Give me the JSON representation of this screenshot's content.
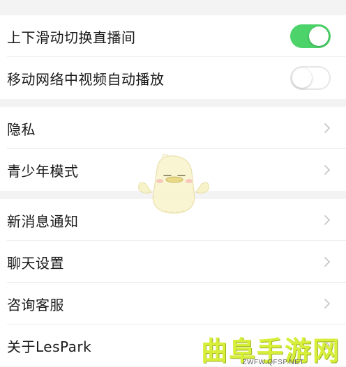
{
  "settings": {
    "group1": [
      {
        "label": "上下滑动切换直播间",
        "toggle_on": true
      },
      {
        "label": "移动网络中视频自动播放",
        "toggle_on": false
      }
    ],
    "group2": [
      {
        "label": "隐私"
      },
      {
        "label": "青少年模式"
      }
    ],
    "group3": [
      {
        "label": "新消息通知"
      },
      {
        "label": "聊天设置"
      },
      {
        "label": "咨询客服"
      },
      {
        "label": "关于LesPark"
      }
    ]
  },
  "watermark": {
    "brand": "曲阜手游网",
    "url": "ZWFW.QFSP.NET"
  },
  "colors": {
    "toggle_on": "#4cd36a",
    "toggle_off_border": "#e6e6e6",
    "background": "#f3f3f4",
    "row_background": "#ffffff",
    "chevron": "#c7c7cc",
    "watermark": "#d8ef3a"
  },
  "icons": {
    "row_chevron": "chevron-right-icon",
    "mascot": "duck-mascot"
  }
}
